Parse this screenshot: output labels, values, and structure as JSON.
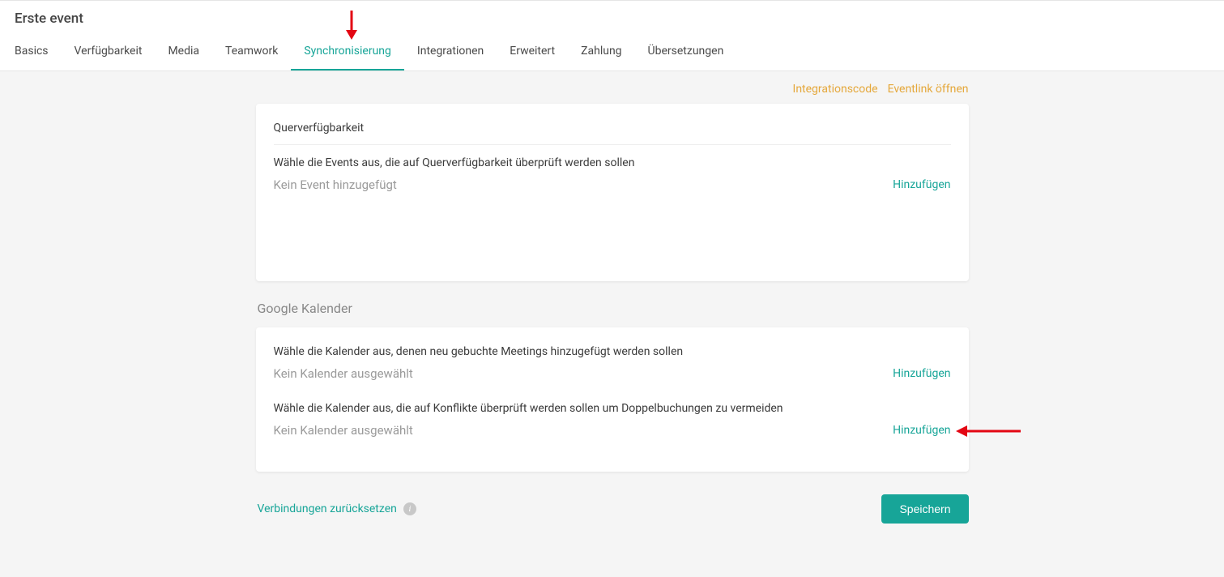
{
  "page_title": "Erste event",
  "tabs": [
    {
      "label": "Basics"
    },
    {
      "label": "Verfügbarkeit"
    },
    {
      "label": "Media"
    },
    {
      "label": "Teamwork"
    },
    {
      "label": "Synchronisierung"
    },
    {
      "label": "Integrationen"
    },
    {
      "label": "Erweitert"
    },
    {
      "label": "Zahlung"
    },
    {
      "label": "Übersetzungen"
    }
  ],
  "active_tab_index": 4,
  "top_links": {
    "integration_code": "Integrationscode",
    "open_event_link": "Eventlink öffnen"
  },
  "cross_card": {
    "title": "Querverfügbarkeit",
    "description": "Wähle die Events aus, die auf Querverfügbarkeit überprüft werden sollen",
    "empty": "Kein Event hinzugefügt",
    "add": "Hinzufügen"
  },
  "google_section_title": "Google Kalender",
  "google_card": {
    "add_to": {
      "description": "Wähle die Kalender aus, denen neu gebuchte Meetings hinzugefügt werden sollen",
      "empty": "Kein Kalender ausgewählt",
      "add": "Hinzufügen"
    },
    "conflict": {
      "description": "Wähle die Kalender aus, die auf Konflikte überprüft werden sollen um Doppelbuchungen zu vermeiden",
      "empty": "Kein Kalender ausgewählt",
      "add": "Hinzufügen"
    }
  },
  "footer": {
    "reset": "Verbindungen zurücksetzen",
    "save": "Speichern"
  }
}
